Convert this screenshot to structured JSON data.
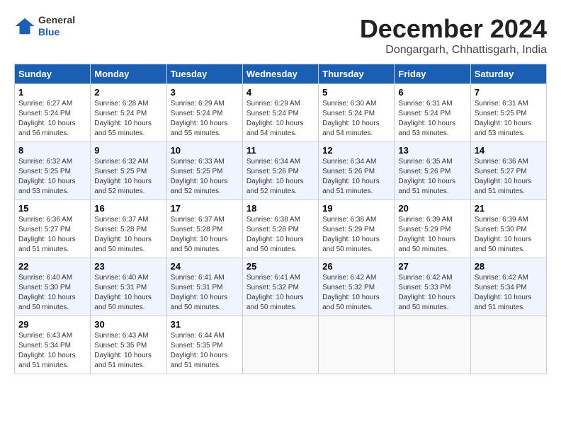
{
  "logo": {
    "line1": "General",
    "line2": "Blue"
  },
  "header": {
    "title": "December 2024",
    "location": "Dongargarh, Chhattisgarh, India"
  },
  "weekdays": [
    "Sunday",
    "Monday",
    "Tuesday",
    "Wednesday",
    "Thursday",
    "Friday",
    "Saturday"
  ],
  "weeks": [
    [
      {
        "day": "1",
        "sunrise": "6:27 AM",
        "sunset": "5:24 PM",
        "daylight": "10 hours and 56 minutes."
      },
      {
        "day": "2",
        "sunrise": "6:28 AM",
        "sunset": "5:24 PM",
        "daylight": "10 hours and 55 minutes."
      },
      {
        "day": "3",
        "sunrise": "6:29 AM",
        "sunset": "5:24 PM",
        "daylight": "10 hours and 55 minutes."
      },
      {
        "day": "4",
        "sunrise": "6:29 AM",
        "sunset": "5:24 PM",
        "daylight": "10 hours and 54 minutes."
      },
      {
        "day": "5",
        "sunrise": "6:30 AM",
        "sunset": "5:24 PM",
        "daylight": "10 hours and 54 minutes."
      },
      {
        "day": "6",
        "sunrise": "6:31 AM",
        "sunset": "5:24 PM",
        "daylight": "10 hours and 53 minutes."
      },
      {
        "day": "7",
        "sunrise": "6:31 AM",
        "sunset": "5:25 PM",
        "daylight": "10 hours and 53 minutes."
      }
    ],
    [
      {
        "day": "8",
        "sunrise": "6:32 AM",
        "sunset": "5:25 PM",
        "daylight": "10 hours and 53 minutes."
      },
      {
        "day": "9",
        "sunrise": "6:32 AM",
        "sunset": "5:25 PM",
        "daylight": "10 hours and 52 minutes."
      },
      {
        "day": "10",
        "sunrise": "6:33 AM",
        "sunset": "5:25 PM",
        "daylight": "10 hours and 52 minutes."
      },
      {
        "day": "11",
        "sunrise": "6:34 AM",
        "sunset": "5:26 PM",
        "daylight": "10 hours and 52 minutes."
      },
      {
        "day": "12",
        "sunrise": "6:34 AM",
        "sunset": "5:26 PM",
        "daylight": "10 hours and 51 minutes."
      },
      {
        "day": "13",
        "sunrise": "6:35 AM",
        "sunset": "5:26 PM",
        "daylight": "10 hours and 51 minutes."
      },
      {
        "day": "14",
        "sunrise": "6:36 AM",
        "sunset": "5:27 PM",
        "daylight": "10 hours and 51 minutes."
      }
    ],
    [
      {
        "day": "15",
        "sunrise": "6:36 AM",
        "sunset": "5:27 PM",
        "daylight": "10 hours and 51 minutes."
      },
      {
        "day": "16",
        "sunrise": "6:37 AM",
        "sunset": "5:28 PM",
        "daylight": "10 hours and 50 minutes."
      },
      {
        "day": "17",
        "sunrise": "6:37 AM",
        "sunset": "5:28 PM",
        "daylight": "10 hours and 50 minutes."
      },
      {
        "day": "18",
        "sunrise": "6:38 AM",
        "sunset": "5:28 PM",
        "daylight": "10 hours and 50 minutes."
      },
      {
        "day": "19",
        "sunrise": "6:38 AM",
        "sunset": "5:29 PM",
        "daylight": "10 hours and 50 minutes."
      },
      {
        "day": "20",
        "sunrise": "6:39 AM",
        "sunset": "5:29 PM",
        "daylight": "10 hours and 50 minutes."
      },
      {
        "day": "21",
        "sunrise": "6:39 AM",
        "sunset": "5:30 PM",
        "daylight": "10 hours and 50 minutes."
      }
    ],
    [
      {
        "day": "22",
        "sunrise": "6:40 AM",
        "sunset": "5:30 PM",
        "daylight": "10 hours and 50 minutes."
      },
      {
        "day": "23",
        "sunrise": "6:40 AM",
        "sunset": "5:31 PM",
        "daylight": "10 hours and 50 minutes."
      },
      {
        "day": "24",
        "sunrise": "6:41 AM",
        "sunset": "5:31 PM",
        "daylight": "10 hours and 50 minutes."
      },
      {
        "day": "25",
        "sunrise": "6:41 AM",
        "sunset": "5:32 PM",
        "daylight": "10 hours and 50 minutes."
      },
      {
        "day": "26",
        "sunrise": "6:42 AM",
        "sunset": "5:32 PM",
        "daylight": "10 hours and 50 minutes."
      },
      {
        "day": "27",
        "sunrise": "6:42 AM",
        "sunset": "5:33 PM",
        "daylight": "10 hours and 50 minutes."
      },
      {
        "day": "28",
        "sunrise": "6:42 AM",
        "sunset": "5:34 PM",
        "daylight": "10 hours and 51 minutes."
      }
    ],
    [
      {
        "day": "29",
        "sunrise": "6:43 AM",
        "sunset": "5:34 PM",
        "daylight": "10 hours and 51 minutes."
      },
      {
        "day": "30",
        "sunrise": "6:43 AM",
        "sunset": "5:35 PM",
        "daylight": "10 hours and 51 minutes."
      },
      {
        "day": "31",
        "sunrise": "6:44 AM",
        "sunset": "5:35 PM",
        "daylight": "10 hours and 51 minutes."
      },
      null,
      null,
      null,
      null
    ]
  ]
}
